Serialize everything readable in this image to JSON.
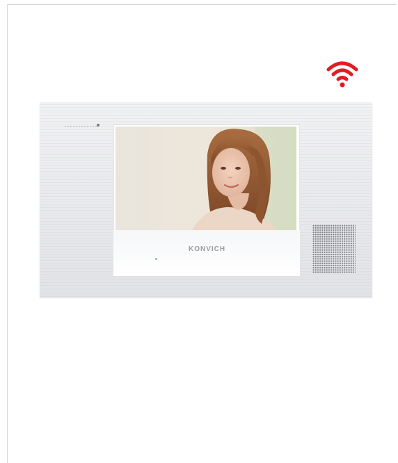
{
  "status": {
    "icon": "wifi-icon",
    "color": "#e31b23"
  },
  "monitor": {
    "brand": "KONVICH",
    "screen_image": "woman-portrait",
    "speaker_icon": "speaker-grille-icon"
  },
  "colors": {
    "accent": "#e31b23",
    "panel": "#ebecef",
    "screen_frame": "#ffffff"
  }
}
